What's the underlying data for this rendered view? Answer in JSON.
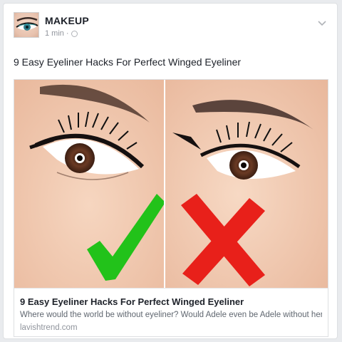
{
  "post": {
    "page_name": "MAKEUP",
    "time": "1 min",
    "separator": "·",
    "text": "9 Easy Eyeliner Hacks For Perfect Winged Eyeliner"
  },
  "link": {
    "title": "9 Easy Eyeliner Hacks For Perfect Winged Eyeliner",
    "description": "Where would the world be without eyeliner? Would Adele even be Adele without her winged liner? ...",
    "domain": "lavishtrend.com"
  },
  "icons": {
    "options": "chevron-down-icon",
    "privacy": "globe-icon",
    "correct": "checkmark-icon",
    "wrong": "cross-icon"
  },
  "colors": {
    "check_green": "#22c21a",
    "cross_red": "#e8201a",
    "skin": "#f0c8b0",
    "iris": "#5a3020"
  }
}
